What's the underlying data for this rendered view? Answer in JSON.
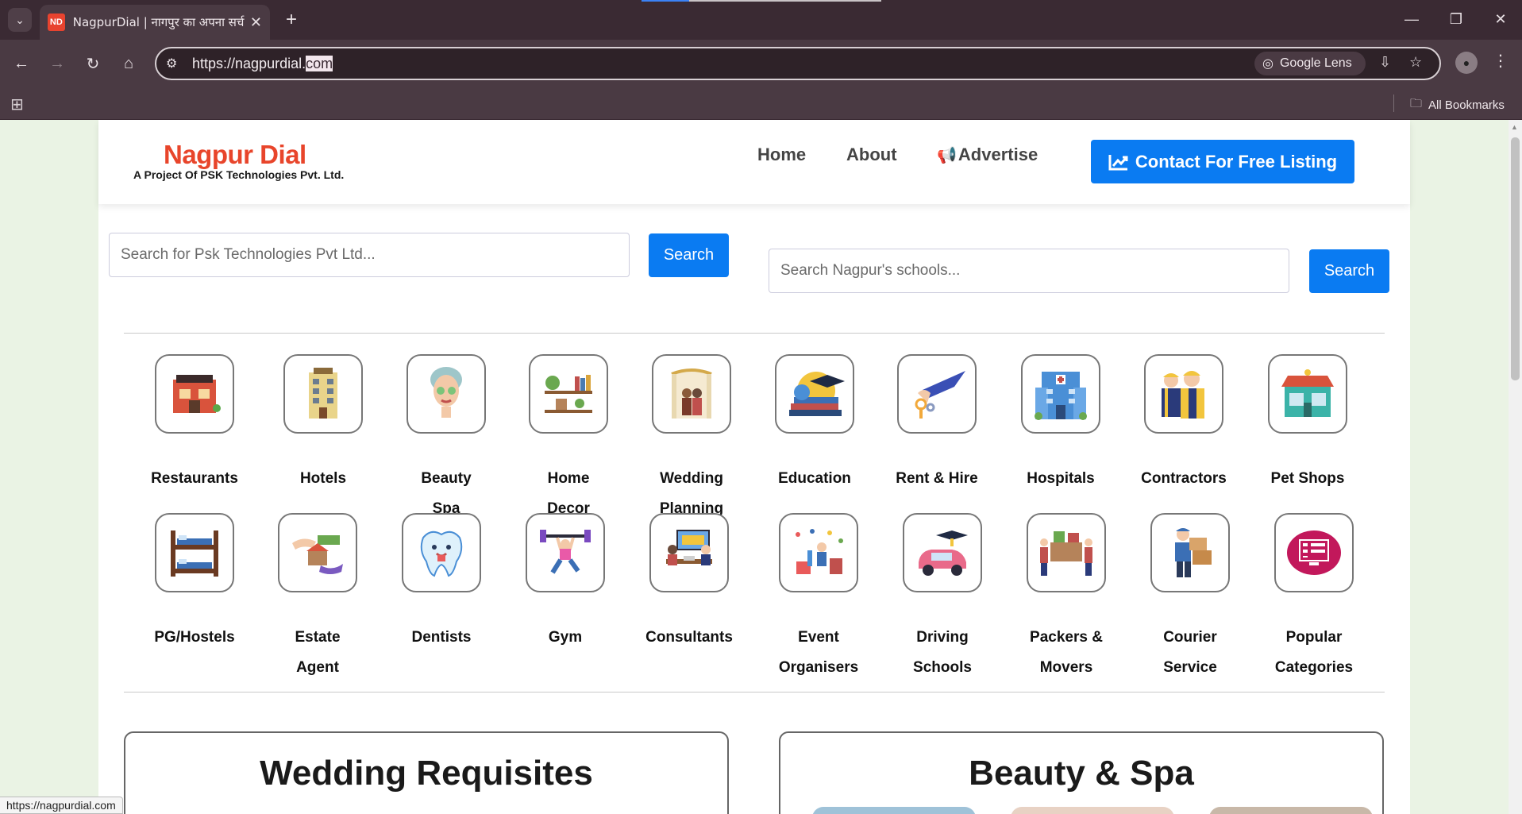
{
  "browser": {
    "tab_title": "NagpurDial | नागपुर का अपना सर्च",
    "favicon_text": "ND",
    "url_prefix": "https://nagpurdial.",
    "url_selected": "com",
    "google_lens_label": "Google Lens",
    "all_bookmarks_label": "All Bookmarks",
    "status_url": "https://nagpurdial.com"
  },
  "header": {
    "logo_main": "Nagpur Dial",
    "logo_sub": "A Project Of PSK Technologies Pvt. Ltd.",
    "nav_home": "Home",
    "nav_about": "About",
    "nav_advertise": "Advertise",
    "cta_label": "Contact For Free Listing"
  },
  "search": {
    "left_placeholder": "Search for Psk Technologies Pvt Ltd...",
    "left_button": "Search",
    "right_placeholder": "Search Nagpur's schools...",
    "right_button": "Search"
  },
  "categories_row1": [
    {
      "label": "Restaurants",
      "icon": "restaurant-icon"
    },
    {
      "label": "Hotels",
      "icon": "hotel-icon"
    },
    {
      "label": "Beauty Spa",
      "icon": "beauty-spa-icon"
    },
    {
      "label": "Home Decor",
      "icon": "home-decor-icon"
    },
    {
      "label": "Wedding Planning",
      "icon": "wedding-icon"
    },
    {
      "label": "Education",
      "icon": "education-icon"
    },
    {
      "label": "Rent & Hire",
      "icon": "rent-hire-icon"
    },
    {
      "label": "Hospitals",
      "icon": "hospital-icon"
    },
    {
      "label": "Contractors",
      "icon": "contractor-icon"
    },
    {
      "label": "Pet Shops",
      "icon": "pet-shop-icon"
    }
  ],
  "categories_row2": [
    {
      "label": "PG/Hostels",
      "icon": "bunk-bed-icon"
    },
    {
      "label": "Estate Agent",
      "icon": "estate-agent-icon"
    },
    {
      "label": "Dentists",
      "icon": "tooth-icon"
    },
    {
      "label": "Gym",
      "icon": "gym-icon"
    },
    {
      "label": "Consultants",
      "icon": "consultant-icon"
    },
    {
      "label": "Event Organisers",
      "icon": "event-icon"
    },
    {
      "label": "Driving Schools",
      "icon": "car-icon"
    },
    {
      "label": "Packers & Movers",
      "icon": "packers-icon"
    },
    {
      "label": "Courier Service",
      "icon": "courier-icon"
    },
    {
      "label": "Popular Categories",
      "icon": "popular-categories-icon"
    }
  ],
  "sections": {
    "left_title": "Wedding Requisites",
    "right_title": "Beauty & Spa"
  },
  "colors": {
    "brand_red": "#e8452b",
    "primary_blue": "#0a7bf2",
    "page_bg": "#eaf3e4"
  }
}
